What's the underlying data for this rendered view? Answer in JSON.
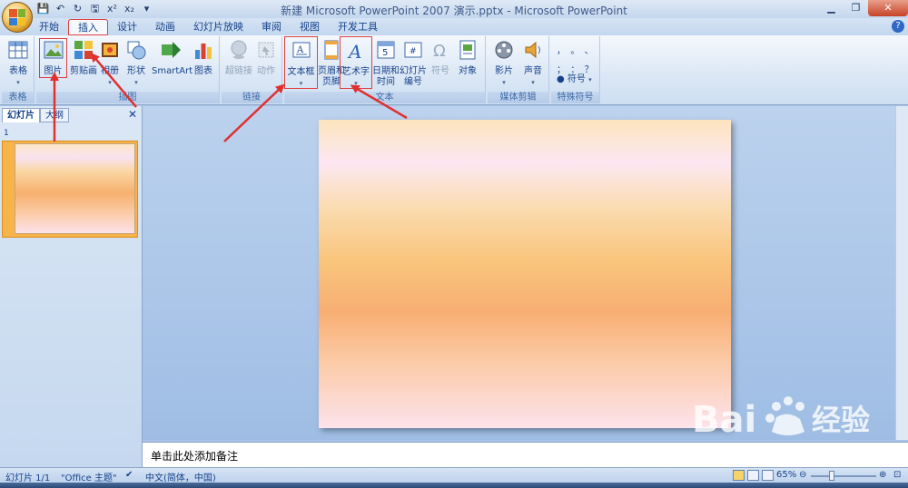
{
  "window": {
    "title": "新建 Microsoft PowerPoint 2007 演示.pptx - Microsoft PowerPoint",
    "qat": [
      "💾",
      "↶",
      "↻",
      "🖫",
      "x²",
      "x₂",
      "▾"
    ]
  },
  "tabs": [
    {
      "label": "开始"
    },
    {
      "label": "插入",
      "active": true
    },
    {
      "label": "设计"
    },
    {
      "label": "动画"
    },
    {
      "label": "幻灯片放映"
    },
    {
      "label": "审阅"
    },
    {
      "label": "视图"
    },
    {
      "label": "开发工具"
    }
  ],
  "ribbon": {
    "groups": {
      "table": "表格",
      "illustrations": "插图",
      "links": "链接",
      "text": "文本",
      "media": "媒体剪辑",
      "symbols": "特殊符号"
    },
    "buttons": {
      "table": "表格",
      "picture": "图片",
      "clipart": "剪贴画",
      "album": "相册",
      "shapes": "形状",
      "smartart": "SmartArt",
      "chart": "图表",
      "hyperlink": "超链接",
      "action": "动作",
      "textbox": "文本框",
      "header_footer_1": "页眉和",
      "header_footer_2": "页脚",
      "wordart": "艺术字",
      "datetime_1": "日期和",
      "datetime_2": "时间",
      "slidenum_1": "幻灯片",
      "slidenum_2": "编号",
      "symbol": "符号",
      "object": "对象",
      "movie": "影片",
      "sound": "声音",
      "special_symbol": "符号"
    },
    "symbols_grid": [
      "，",
      "。",
      "、",
      "；",
      "：",
      "？"
    ]
  },
  "leftpanel": {
    "tab_slides": "幻灯片",
    "tab_outline": "大纲",
    "close": "✕",
    "slide_number": "1"
  },
  "notes": {
    "placeholder": "单击此处添加备注"
  },
  "statusbar": {
    "slide_info": "幻灯片 1/1",
    "theme": "\"Office 主题\"",
    "language": "中文(简体，中国)",
    "zoom": "65%",
    "zoom_fraction": 0.65
  },
  "watermark": {
    "url": "jingyan.baidu.com"
  },
  "colors": {
    "highlight": "#e04040",
    "ribbon": "#dbe7f5",
    "accent_blue": "#15428b"
  }
}
